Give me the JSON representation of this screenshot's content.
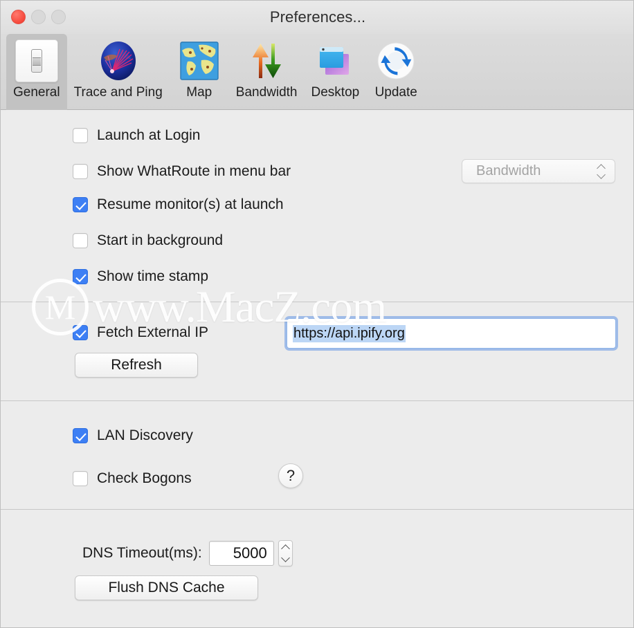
{
  "window": {
    "title": "Preferences...",
    "traffic_lights": [
      {
        "name": "close",
        "state": "active",
        "color": "#f6483b"
      },
      {
        "name": "minimize",
        "state": "disabled",
        "color": "#d9d9d9"
      },
      {
        "name": "zoom",
        "state": "disabled",
        "color": "#d9d9d9"
      }
    ]
  },
  "toolbar": {
    "items": [
      {
        "label": "General",
        "icon": "switch-icon",
        "selected": true
      },
      {
        "label": "Trace and Ping",
        "icon": "globe-traceroute-icon",
        "selected": false
      },
      {
        "label": "Map",
        "icon": "world-map-icon",
        "selected": false
      },
      {
        "label": "Bandwidth",
        "icon": "up-down-arrows-icon",
        "selected": false
      },
      {
        "label": "Desktop",
        "icon": "windows-stack-icon",
        "selected": false
      },
      {
        "label": "Update",
        "icon": "refresh-circle-icon",
        "selected": false
      }
    ]
  },
  "general": {
    "checkboxes": [
      {
        "label": "Launch at Login",
        "checked": false
      },
      {
        "label": "Show WhatRoute in menu bar",
        "checked": false
      },
      {
        "label": "Resume monitor(s) at launch",
        "checked": true
      },
      {
        "label": "Start in background",
        "checked": false
      },
      {
        "label": "Show time stamp",
        "checked": true
      }
    ],
    "monitor_select": {
      "value": "Bandwidth",
      "enabled": false,
      "options": [
        "Bandwidth"
      ]
    },
    "external_ip": {
      "checkbox_label": "Fetch External IP",
      "checked": true,
      "url_value": "https://api.ipify.org",
      "url_selected": true,
      "refresh_label": "Refresh"
    },
    "lan": {
      "discovery_label": "LAN Discovery",
      "discovery_checked": true,
      "bogons_label": "Check Bogons",
      "bogons_checked": false,
      "help_label": "?"
    },
    "dns": {
      "timeout_label": "DNS Timeout(ms):",
      "timeout_value": "5000",
      "flush_label": "Flush DNS Cache"
    }
  },
  "watermark": {
    "logo_letter": "M",
    "text": "www.MacZ.com"
  },
  "colors": {
    "accent": "#3d7ff4",
    "window_bg": "#ececec",
    "toolbar_bg": "#d6d6d6",
    "focus_ring": "#6396e6"
  }
}
